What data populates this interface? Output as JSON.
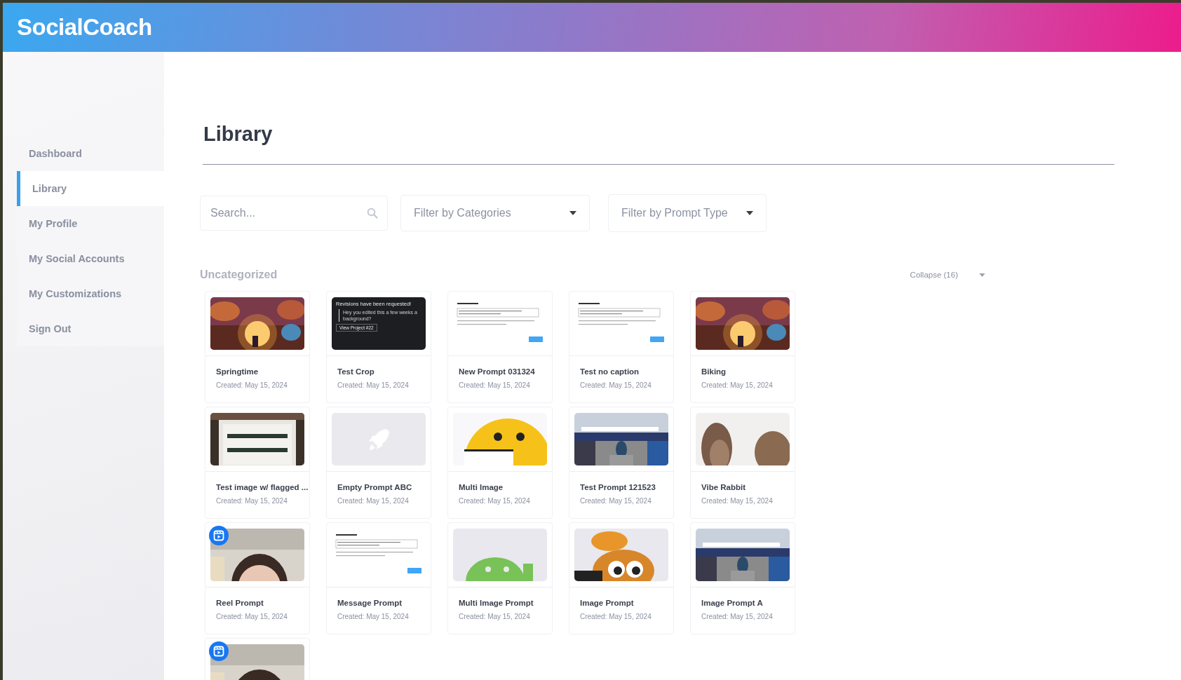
{
  "header": {
    "logo": "SocialCoach"
  },
  "sidebar": {
    "items": [
      {
        "label": "Dashboard",
        "selected": false
      },
      {
        "label": "Library",
        "selected": true
      },
      {
        "label": "My Profile",
        "selected": false
      },
      {
        "label": "My Social Accounts",
        "selected": false
      },
      {
        "label": "My Customizations",
        "selected": false
      },
      {
        "label": "Sign Out",
        "selected": false
      }
    ]
  },
  "page": {
    "title": "Library"
  },
  "filters": {
    "search": {
      "placeholder": "Search..."
    },
    "categories": {
      "label": "Filter by Categories"
    },
    "prompt_type": {
      "label": "Filter by Prompt Type"
    }
  },
  "group": {
    "title": "Uncategorized",
    "toggle": "Collapse (16)"
  },
  "cards": [
    {
      "title": "Springtime",
      "created": "Created: May 15, 2024",
      "reel": false
    },
    {
      "title": "Test Crop",
      "created": "Created: May 15, 2024",
      "thumb": {
        "kind": "dark-note",
        "heading": "Revisions have been requested!",
        "quote": "Hey you edited this a few weeks a background?",
        "link": "View Project #22"
      },
      "reel": false
    },
    {
      "title": "New Prompt 031324",
      "created": "Created: May 15, 2024",
      "thumb": {
        "kind": "document"
      },
      "reel": false
    },
    {
      "title": "Test no caption",
      "created": "Created: May 15, 2024",
      "thumb": {
        "kind": "document"
      },
      "reel": false
    },
    {
      "title": "Biking",
      "created": "Created: May 15, 2024",
      "reel": false
    },
    {
      "title": "Test image w/ flagged ...",
      "created": "Created: May 15, 2024",
      "reel": false
    },
    {
      "title": "Empty Prompt ABC",
      "created": "Created: May 15, 2024",
      "thumb": {
        "kind": "empty"
      },
      "reel": false
    },
    {
      "title": "Multi Image",
      "created": "Created: May 15, 2024",
      "reel": false
    },
    {
      "title": "Test Prompt 121523",
      "created": "Created: May 15, 2024",
      "reel": false
    },
    {
      "title": "Vibe Rabbit",
      "created": "Created: May 15, 2024",
      "reel": false
    },
    {
      "title": "Reel Prompt",
      "created": "Created: May 15, 2024",
      "reel": true
    },
    {
      "title": "Message Prompt",
      "created": "Created: May 15, 2024",
      "thumb": {
        "kind": "document"
      },
      "reel": false
    },
    {
      "title": "Multi Image Prompt",
      "created": "Created: May 15, 2024",
      "reel": false
    },
    {
      "title": "Image Prompt",
      "created": "Created: May 15, 2024",
      "reel": false
    },
    {
      "title": "Image Prompt A",
      "created": "Created: May 15, 2024",
      "reel": false
    },
    {
      "reel": true
    }
  ]
}
